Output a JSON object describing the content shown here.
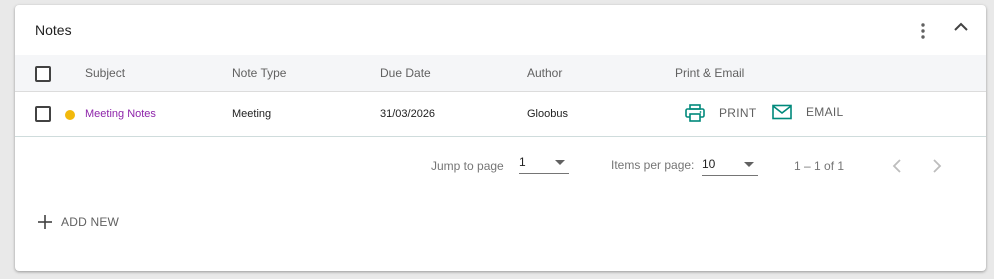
{
  "card": {
    "title": "Notes",
    "more_icon": "more-vertical-icon",
    "collapse_icon": "chevron-up-icon"
  },
  "table": {
    "columns": {
      "subject": "Subject",
      "note_type": "Note Type",
      "due_date": "Due Date",
      "author": "Author",
      "print_email": "Print & Email"
    },
    "rows": [
      {
        "status_color": "#f2b90c",
        "subject": "Meeting Notes",
        "note_type": "Meeting",
        "due_date": "31/03/2026",
        "author": "Gloobus",
        "print_label": "PRINT",
        "email_label": "EMAIL"
      }
    ]
  },
  "pagination": {
    "jump_label": "Jump to page",
    "jump_value": "1",
    "items_per_page_label": "Items per page:",
    "items_per_page_value": "10",
    "range_text": "1 – 1 of 1"
  },
  "add_new": {
    "label": "ADD NEW"
  },
  "colors": {
    "accent_teal": "#00897b",
    "link_purple": "#8e24aa"
  }
}
